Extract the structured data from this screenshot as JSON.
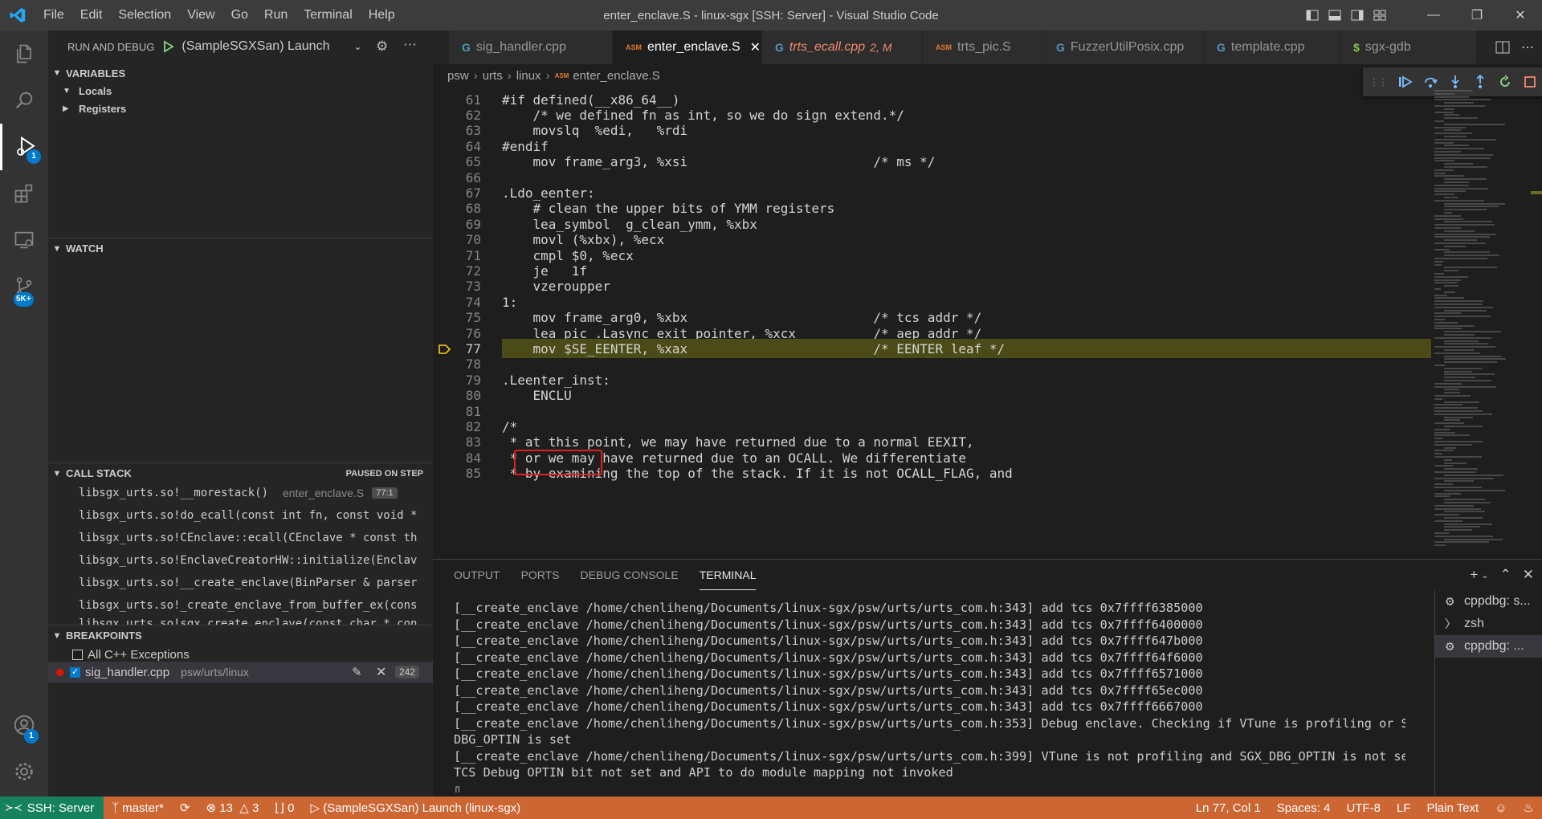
{
  "window": {
    "title": "enter_enclave.S - linux-sgx [SSH: Server] - Visual Studio Code",
    "menu": [
      "File",
      "Edit",
      "Selection",
      "View",
      "Go",
      "Run",
      "Terminal",
      "Help"
    ]
  },
  "activity_bar": {
    "run_badge": "1",
    "remote_badge": "5K+",
    "account_badge": "1"
  },
  "sidebar": {
    "header": "RUN AND DEBUG",
    "launch_config": "(SampleSGXSan) Launch",
    "variables": {
      "title": "VARIABLES",
      "items": [
        "Locals",
        "Registers"
      ]
    },
    "watch": {
      "title": "WATCH"
    },
    "call_stack": {
      "title": "CALL STACK",
      "status": "PAUSED ON STEP",
      "frames": [
        {
          "name": "libsgx_urts.so!__morestack()",
          "file": "enter_enclave.S",
          "pos": "77:1"
        },
        {
          "name": "libsgx_urts.so!do_ecall(const int fn, const void *",
          "file": "",
          "pos": ""
        },
        {
          "name": "libsgx_urts.so!CEnclave::ecall(CEnclave * const th",
          "file": "",
          "pos": ""
        },
        {
          "name": "libsgx_urts.so!EnclaveCreatorHW::initialize(Enclav",
          "file": "",
          "pos": ""
        },
        {
          "name": "libsgx_urts.so!__create_enclave(BinParser & parser",
          "file": "",
          "pos": ""
        },
        {
          "name": "libsgx_urts.so!_create_enclave_from_buffer_ex(cons",
          "file": "",
          "pos": ""
        },
        {
          "name": "libsgx_urts.so!sgx_create_enclave(const char * con",
          "file": "",
          "pos": ""
        }
      ]
    },
    "breakpoints": {
      "title": "BREAKPOINTS",
      "all_cpp_exceptions": "All C++ Exceptions",
      "file": "sig_handler.cpp",
      "path": "psw/urts/linux",
      "line": "242"
    }
  },
  "tabs": [
    {
      "label": "sig_handler.cpp",
      "icon": "cpp",
      "active": false,
      "modified": ""
    },
    {
      "label": "enter_enclave.S",
      "icon": "asm",
      "active": true,
      "modified": ""
    },
    {
      "label": "trts_ecall.cpp",
      "icon": "cpp",
      "active": false,
      "modified": "2, M"
    },
    {
      "label": "trts_pic.S",
      "icon": "asm",
      "active": false,
      "modified": ""
    },
    {
      "label": "FuzzerUtilPosix.cpp",
      "icon": "cpp",
      "active": false,
      "modified": ""
    },
    {
      "label": "template.cpp",
      "icon": "cpp",
      "active": false,
      "modified": ""
    },
    {
      "label": "sgx-gdb",
      "icon": "dollar",
      "active": false,
      "modified": ""
    }
  ],
  "breadcrumb": [
    "psw",
    "urts",
    "linux",
    "enter_enclave.S"
  ],
  "editor": {
    "current_line": 77,
    "lines": [
      {
        "n": "61",
        "t": "#if defined(__x86_64__)"
      },
      {
        "n": "62",
        "t": "    /* we defined fn as int, so we do sign extend.*/"
      },
      {
        "n": "63",
        "t": "    movslq  %edi,   %rdi"
      },
      {
        "n": "64",
        "t": "#endif"
      },
      {
        "n": "65",
        "t": "    mov frame_arg3, %xsi                        /* ms */"
      },
      {
        "n": "66",
        "t": ""
      },
      {
        "n": "67",
        "t": ".Ldo_eenter:"
      },
      {
        "n": "68",
        "t": "    # clean the upper bits of YMM registers"
      },
      {
        "n": "69",
        "t": "    lea_symbol  g_clean_ymm, %xbx"
      },
      {
        "n": "70",
        "t": "    movl (%xbx), %ecx"
      },
      {
        "n": "71",
        "t": "    cmpl $0, %ecx"
      },
      {
        "n": "72",
        "t": "    je   1f"
      },
      {
        "n": "73",
        "t": "    vzeroupper"
      },
      {
        "n": "74",
        "t": "1:"
      },
      {
        "n": "75",
        "t": "    mov frame_arg0, %xbx                        /* tcs addr */"
      },
      {
        "n": "76",
        "t": "    lea_pic .Lasync_exit_pointer, %xcx          /* aep addr */"
      },
      {
        "n": "77",
        "t": "    mov $SE_EENTER, %xax                        /* EENTER leaf */"
      },
      {
        "n": "78",
        "t": ""
      },
      {
        "n": "79",
        "t": ".Leenter_inst:"
      },
      {
        "n": "80",
        "t": "    ENCLU"
      },
      {
        "n": "81",
        "t": ""
      },
      {
        "n": "82",
        "t": "/*"
      },
      {
        "n": "83",
        "t": " * at this point, we may have returned due to a normal EEXIT,"
      },
      {
        "n": "84",
        "t": " * or we may have returned due to an OCALL. We differentiate"
      },
      {
        "n": "85",
        "t": " * by examining the top of the stack. If it is not OCALL_FLAG, and"
      }
    ]
  },
  "panel": {
    "tabs": [
      "OUTPUT",
      "PORTS",
      "DEBUG CONSOLE",
      "TERMINAL"
    ],
    "active_tab": "TERMINAL",
    "terminal_lines": [
      "[__create_enclave /home/chenliheng/Documents/linux-sgx/psw/urts/urts_com.h:343] add tcs 0x7ffff6385000",
      "[__create_enclave /home/chenliheng/Documents/linux-sgx/psw/urts/urts_com.h:343] add tcs 0x7ffff6400000",
      "[__create_enclave /home/chenliheng/Documents/linux-sgx/psw/urts/urts_com.h:343] add tcs 0x7ffff647b000",
      "[__create_enclave /home/chenliheng/Documents/linux-sgx/psw/urts/urts_com.h:343] add tcs 0x7ffff64f6000",
      "[__create_enclave /home/chenliheng/Documents/linux-sgx/psw/urts/urts_com.h:343] add tcs 0x7ffff6571000",
      "[__create_enclave /home/chenliheng/Documents/linux-sgx/psw/urts/urts_com.h:343] add tcs 0x7ffff65ec000",
      "[__create_enclave /home/chenliheng/Documents/linux-sgx/psw/urts/urts_com.h:343] add tcs 0x7ffff6667000",
      "[__create_enclave /home/chenliheng/Documents/linux-sgx/psw/urts/urts_com.h:353] Debug enclave. Checking if VTune is profiling or SGX_",
      "DBG_OPTIN is set",
      "[__create_enclave /home/chenliheng/Documents/linux-sgx/psw/urts/urts_com.h:399] VTune is not profiling and SGX_DBG_OPTIN is not set.",
      "TCS Debug OPTIN bit not set and API to do module mapping not invoked",
      "▯"
    ],
    "terminal_instances": [
      {
        "icon": "debug",
        "label": "cppdbg: s..."
      },
      {
        "icon": "terminal",
        "label": "zsh"
      },
      {
        "icon": "debug",
        "label": "cppdbg: ..."
      }
    ]
  },
  "statusbar": {
    "remote": "SSH: Server",
    "branch": "master*",
    "errors": "13",
    "warnings": "3",
    "ports": "0",
    "debug": "(SampleSGXSan) Launch (linux-sgx)",
    "position": "Ln 77, Col 1",
    "spaces": "Spaces: 4",
    "encoding": "UTF-8",
    "eol": "LF",
    "language": "Plain Text"
  },
  "colors": {
    "statusbar": "#cc6633",
    "remote": "#16825d",
    "current_line": "#4b4b18",
    "annotation": "#e01f1f"
  }
}
